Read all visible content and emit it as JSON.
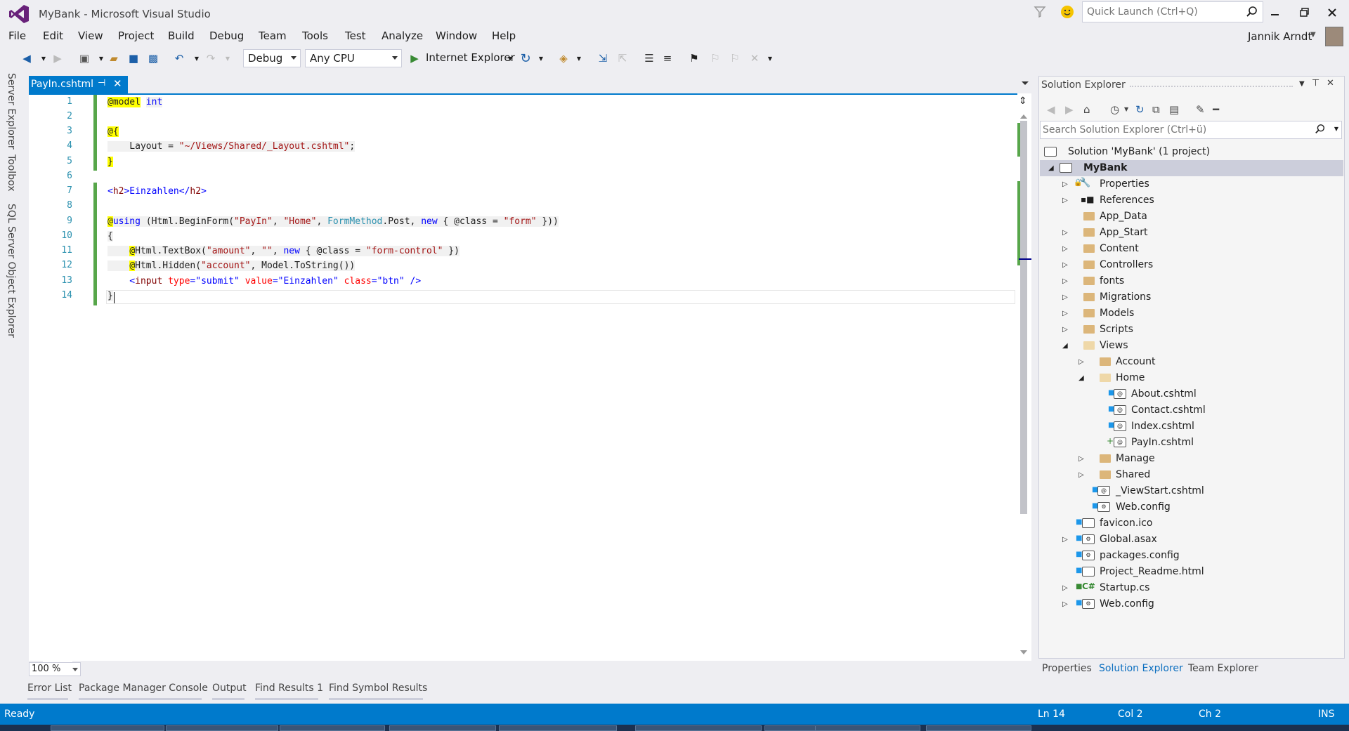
{
  "window": {
    "title": "MyBank - Microsoft Visual Studio",
    "quick_launch_placeholder": "Quick Launch (Ctrl+Q)",
    "user_name": "Jannik Arndt",
    "controls": [
      "minimize",
      "restore",
      "close"
    ]
  },
  "menu": [
    "File",
    "Edit",
    "View",
    "Project",
    "Build",
    "Debug",
    "Team",
    "Tools",
    "Test",
    "Analyze",
    "Window",
    "Help"
  ],
  "toolbar": {
    "configuration": "Debug",
    "platform": "Any CPU",
    "run_target": "Internet Explorer"
  },
  "side_tabs": [
    "Server Explorer",
    "Toolbox",
    "SQL Server Object Explorer"
  ],
  "editor": {
    "tab_title": "PayIn.cshtml",
    "zoom": "100 %",
    "line_numbers": [
      "1",
      "2",
      "3",
      "4",
      "5",
      "6",
      "7",
      "8",
      "9",
      "10",
      "11",
      "12",
      "13",
      "14"
    ],
    "code": {
      "l1_a": "@model",
      "l1_b": "int",
      "l3": "@{",
      "l4_a": "    Layout = ",
      "l4_b": "\"~/Views/Shared/_Layout.cshtml\"",
      "l4_c": ";",
      "l5": "}",
      "l7_a": "<",
      "l7_b": "h2",
      "l7_c": ">Einzahlen</",
      "l7_d": "h2",
      "l7_e": ">",
      "l9_a": "@",
      "l9_b": "using",
      "l9_c": " (Html.BeginForm(",
      "l9_d": "\"PayIn\"",
      "l9_e": ", ",
      "l9_f": "\"Home\"",
      "l9_g": ", ",
      "l9_h": "FormMethod",
      "l9_i": ".Post, ",
      "l9_j": "new",
      "l9_k": " { @class = ",
      "l9_l": "\"form\"",
      "l9_m": " }))",
      "l10": "{",
      "l11_a": "    ",
      "l11_b": "@",
      "l11_c": "Html.TextBox(",
      "l11_d": "\"amount\"",
      "l11_e": ", ",
      "l11_f": "\"\"",
      "l11_g": ", ",
      "l11_h": "new",
      "l11_i": " { @class = ",
      "l11_j": "\"form-control\"",
      "l11_k": " })",
      "l12_a": "    ",
      "l12_b": "@",
      "l12_c": "Html.Hidden(",
      "l12_d": "\"account\"",
      "l12_e": ", Model.ToString())",
      "l13_a": "    <",
      "l13_b": "input",
      "l13_c": " ",
      "l13_d": "type",
      "l13_e": "=",
      "l13_f": "\"submit\"",
      "l13_g": " ",
      "l13_h": "value",
      "l13_i": "=",
      "l13_j": "\"Einzahlen\"",
      "l13_k": " ",
      "l13_l": "class",
      "l13_m": "=",
      "l13_n": "\"btn\"",
      "l13_o": " />",
      "l14": "}"
    }
  },
  "bottom_tabs": [
    "Error List",
    "Package Manager Console",
    "Output",
    "Find Results 1",
    "Find Symbol Results"
  ],
  "solution_explorer": {
    "title": "Solution Explorer",
    "search_placeholder": "Search Solution Explorer (Ctrl+ü)",
    "solution": "Solution 'MyBank' (1 project)",
    "project": "MyBank",
    "items": {
      "properties": "Properties",
      "references": "References",
      "app_data": "App_Data",
      "app_start": "App_Start",
      "content": "Content",
      "controllers": "Controllers",
      "fonts": "fonts",
      "migrations": "Migrations",
      "models": "Models",
      "scripts": "Scripts",
      "views": "Views",
      "account": "Account",
      "home": "Home",
      "about": "About.cshtml",
      "contact": "Contact.cshtml",
      "index": "Index.cshtml",
      "payin": "PayIn.cshtml",
      "manage": "Manage",
      "shared": "Shared",
      "viewstart": "_ViewStart.cshtml",
      "views_webconfig": "Web.config",
      "favicon": "favicon.ico",
      "global": "Global.asax",
      "packages": "packages.config",
      "readme": "Project_Readme.html",
      "startup": "Startup.cs",
      "webconfig": "Web.config"
    },
    "bottom_tabs": [
      "Properties",
      "Solution Explorer",
      "Team Explorer"
    ]
  },
  "status": {
    "state": "Ready",
    "line": "Ln 14",
    "col": "Col 2",
    "ch": "Ch 2",
    "mode": "INS"
  },
  "colors": {
    "accent": "#007ACC",
    "keyword": "#0000FF",
    "string": "#A31515",
    "type": "#2B91AF",
    "change_margin": "#57A64A",
    "razor_highlight": "#FFFF00"
  }
}
